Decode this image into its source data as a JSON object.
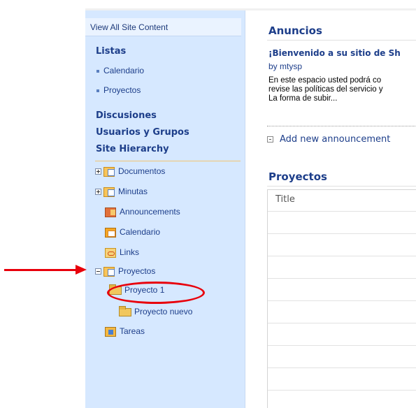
{
  "nav": {
    "view_all": "View All Site Content",
    "listas_header": "Listas",
    "listas_items": [
      "Calendario",
      "Proyectos"
    ],
    "discusiones": "Discusiones",
    "usuarios": "Usuarios y Grupos",
    "hierarchy": "Site Hierarchy",
    "tree": [
      {
        "label": "Documentos",
        "icon": "document-library-icon",
        "expander": "plus"
      },
      {
        "label": "Minutas",
        "icon": "document-library-icon",
        "expander": "plus"
      },
      {
        "label": "Announcements",
        "icon": "announcements-icon"
      },
      {
        "label": "Calendario",
        "icon": "calendar-icon"
      },
      {
        "label": "Links",
        "icon": "links-icon"
      },
      {
        "label": "Proyectos",
        "icon": "document-library-icon",
        "expander": "minus"
      },
      {
        "label": "Proyecto 1",
        "icon": "folder-icon"
      },
      {
        "label": "Proyecto nuevo",
        "icon": "folder-icon"
      },
      {
        "label": "Tareas",
        "icon": "tasks-icon"
      }
    ]
  },
  "main": {
    "anuncios_title": "Anuncios",
    "welcome": "¡Bienvenido a su sitio de Sh",
    "by": "by mtysp",
    "body_lines": [
      "En este espacio usted podrá co",
      "revise las políticas del servicio y",
      "La forma de subir..."
    ],
    "add_new": "Add new announcement",
    "proyectos_title": "Proyectos",
    "column_title": "Title"
  },
  "colors": {
    "nav_bg": "#d6e8ff",
    "link": "#1d3e8a",
    "annotation": "#e8000b"
  }
}
